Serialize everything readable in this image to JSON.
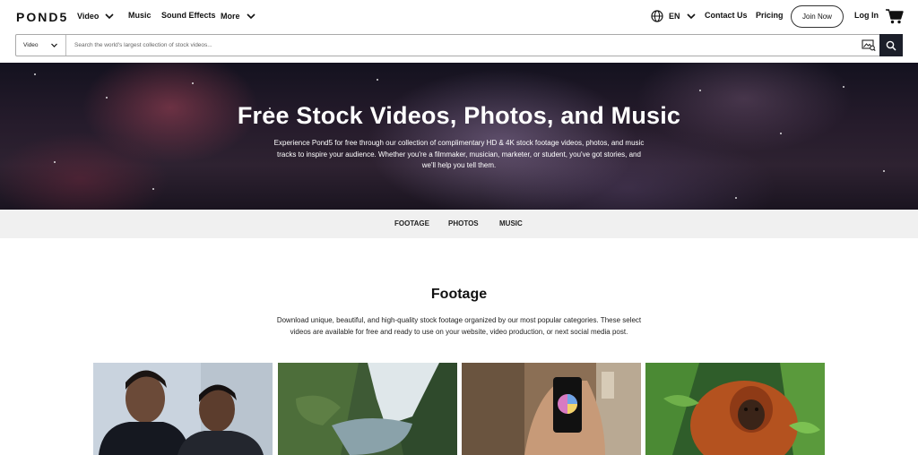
{
  "nav": {
    "logo": "POND5",
    "video": "Video",
    "music": "Music",
    "sound_effects": "Sound Effects",
    "more": "More",
    "language": "EN",
    "contact": "Contact Us",
    "pricing": "Pricing",
    "join": "Join Now",
    "login": "Log In",
    "icons": [
      "chevron-down-icon",
      "globe-icon",
      "cart-icon"
    ]
  },
  "search": {
    "category": "Video",
    "placeholder": "Search the world's largest collection of stock videos...",
    "icons": [
      "image-search-icon",
      "search-icon"
    ]
  },
  "hero": {
    "title": "Free Stock Videos, Photos, and Music",
    "subtitle": "Experience Pond5 for free through our collection of complimentary HD & 4K stock footage videos, photos, and music tracks to inspire your audience. Whether you're a filmmaker, musician, marketer, or student, you've got stories, and we'll help you tell them."
  },
  "tabs": [
    "FOOTAGE",
    "PHOTOS",
    "MUSIC"
  ],
  "footage": {
    "title": "Footage",
    "description": "Download unique, beautiful, and high-quality stock footage organized by our most popular categories. These select videos are available for free and ready to use on your website, video production, or next social media post."
  },
  "colors": {
    "dark_button": "#1c1f2a",
    "tab_strip": "#f0f0f0",
    "text": "#111111"
  }
}
